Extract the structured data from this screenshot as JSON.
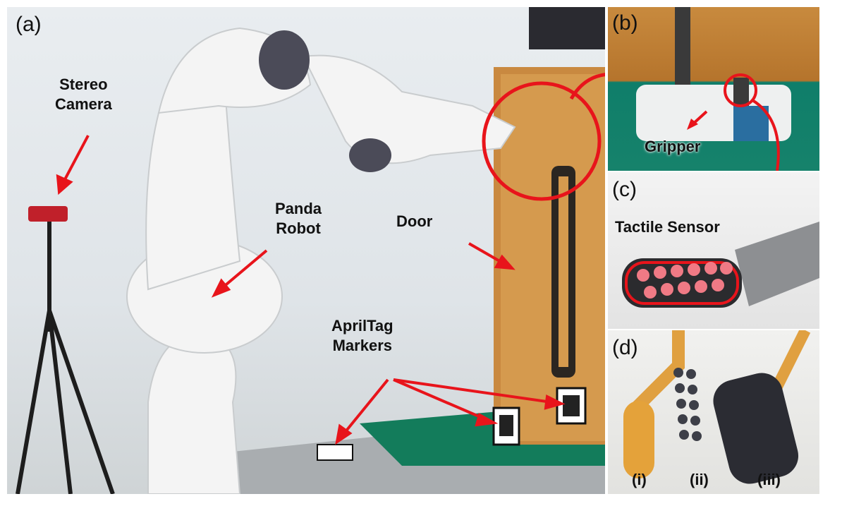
{
  "panels": {
    "a": {
      "tag": "(a)",
      "labels": {
        "stereo_camera": [
          "Stereo",
          "Camera"
        ],
        "panda_robot": [
          "Panda",
          "Robot"
        ],
        "door": "Door",
        "apriltag": [
          "AprilTag",
          "Markers"
        ]
      }
    },
    "b": {
      "tag": "(b)",
      "gripper": "Gripper"
    },
    "c": {
      "tag": "(c)",
      "tactile": "Tactile Sensor"
    },
    "d": {
      "tag": "(d)",
      "items": [
        "(i)",
        "(ii)",
        "(iii)"
      ]
    }
  },
  "colors": {
    "annotation": "#e8141b",
    "wood": "#c98940",
    "robot": "#f4f4f4",
    "green_base": "#127c5a",
    "sensor_dots": "#f07a85"
  }
}
